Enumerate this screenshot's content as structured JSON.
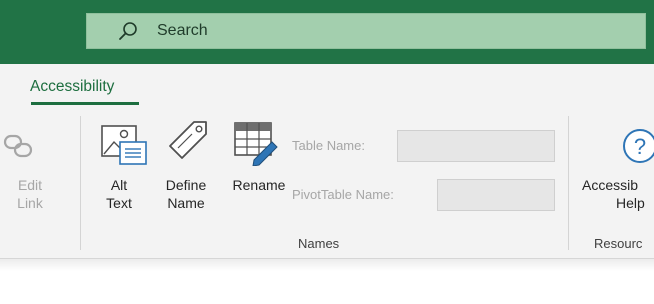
{
  "search": {
    "text": "Search"
  },
  "tabs": [
    {
      "label": "Accessibility"
    }
  ],
  "buttons": {
    "edit_link": {
      "line1": "Edit",
      "line2": "Link"
    },
    "alt_text": {
      "line1": "Alt",
      "line2": "Text"
    },
    "define_name": {
      "line1": "Define",
      "line2": "Name"
    },
    "rename": {
      "line1": "Rename"
    },
    "accessibility_help": {
      "line1": "Accessib",
      "line2": "Help"
    }
  },
  "fields": {
    "table_name": {
      "label": "Table Name:",
      "value": ""
    },
    "pivot_table_name": {
      "label": "PivotTable Name:",
      "value": ""
    }
  },
  "groups": {
    "names": "Names",
    "resources": "Resourc"
  },
  "colors": {
    "titlebar": "#217346",
    "accent": "#1d6e3f",
    "ribbon": "#f3f3f3"
  },
  "icons": [
    "search-icon",
    "edit-link-icon",
    "alt-text-icon",
    "define-name-icon",
    "rename-table-icon",
    "help-icon"
  ]
}
